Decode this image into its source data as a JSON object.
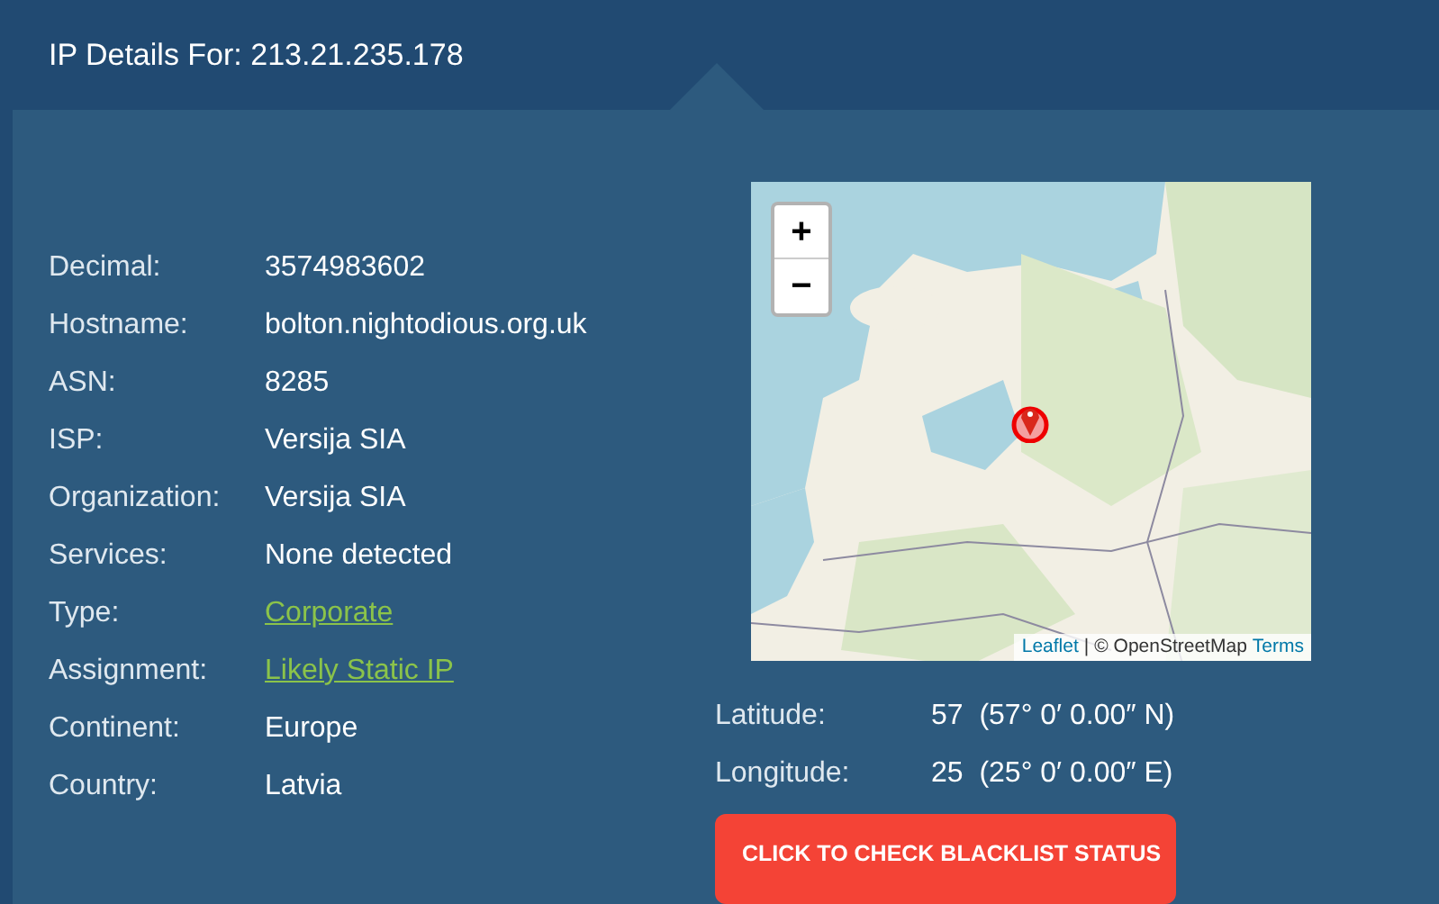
{
  "header": {
    "title": "IP Details For: 213.21.235.178"
  },
  "details": [
    {
      "label": "Decimal:",
      "value": "3574983602",
      "kind": "text"
    },
    {
      "label": "Hostname:",
      "value": "bolton.nightodious.org.uk",
      "kind": "text"
    },
    {
      "label": "ASN:",
      "value": "8285",
      "kind": "text"
    },
    {
      "label": "ISP:",
      "value": "Versija SIA",
      "kind": "text"
    },
    {
      "label": "Organization:",
      "value": "Versija SIA",
      "kind": "text"
    },
    {
      "label": "Services:",
      "value": "None detected",
      "kind": "text"
    },
    {
      "label": "Type:",
      "value": "Corporate",
      "kind": "link"
    },
    {
      "label": "Assignment:",
      "value": "Likely Static IP",
      "kind": "link"
    },
    {
      "label": "Continent:",
      "value": "Europe",
      "kind": "text"
    },
    {
      "label": "Country:",
      "value": "Latvia",
      "kind": "text"
    }
  ],
  "map": {
    "kind": "picture",
    "zoom_in": "+",
    "zoom_out": "−",
    "attribution": [
      {
        "text": "Leaflet",
        "kind": "link"
      },
      {
        "text": "|",
        "kind": "text"
      },
      {
        "text": "© OpenStreetMap",
        "kind": "text"
      },
      {
        "text": "Terms",
        "kind": "link"
      }
    ]
  },
  "coordinates": [
    {
      "label": "Latitude:",
      "value": "57  (57° 0′ 0.00″ N)"
    },
    {
      "label": "Longitude:",
      "value": "25  (25° 0′ 0.00″ E)"
    }
  ],
  "blacklist_button": "CLICK TO CHECK BLACKLIST STATUS"
}
